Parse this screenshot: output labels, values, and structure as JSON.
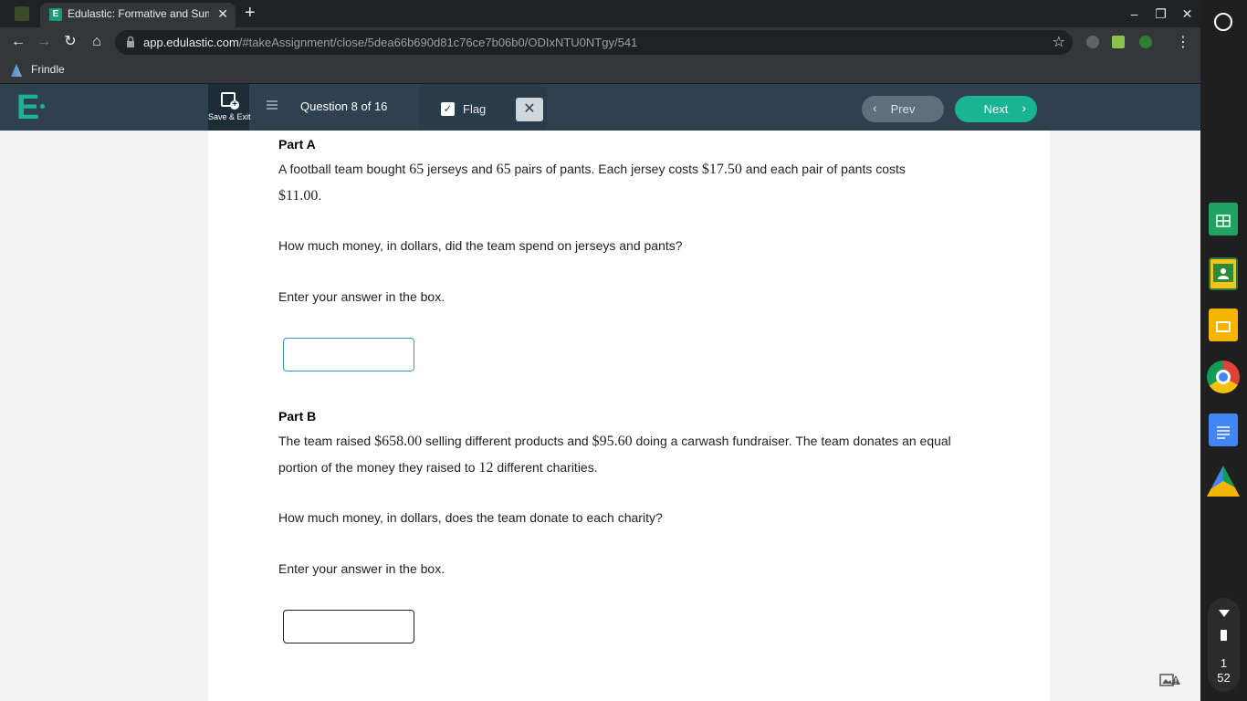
{
  "browser": {
    "tab_title": "Edulastic: Formative and Summ",
    "tab_close": "✕",
    "new_tab": "+",
    "url_host": "app.edulastic.com",
    "url_path": "/#takeAssignment/close/5dea66b690d81c76ce7b06b0/ODIxNTU0NTgy/541",
    "bookmark_label": "Frindle",
    "icons": [
      "back-icon",
      "forward-icon",
      "reload-icon",
      "home-icon",
      "lock-icon",
      "star-icon",
      "menu-icon"
    ]
  },
  "app": {
    "logo": "E",
    "save_exit_label": "Save & Exit",
    "question_counter": "Question 8 of 16",
    "flag_label": "Flag",
    "flag_checked": true,
    "close_symbol": "✕",
    "prev_label": "Prev",
    "next_label": "Next",
    "accent_color": "#1ab394",
    "header_color": "#2f4151"
  },
  "question": {
    "part_a": {
      "title": "Part A",
      "line1_pre": "A football team bought ",
      "num1": "65",
      "line1_mid1": " jerseys and ",
      "num2": "65",
      "line1_mid2": " pairs of pants. Each jersey costs ",
      "num3": "$17.50",
      "line1_post": " and each pair of pants costs",
      "num4": "$11.00",
      "line2_post": ".",
      "prompt": "How much money, in dollars, did the team spend on jerseys and pants?",
      "instruction": "Enter your answer in the box.",
      "answer_value": ""
    },
    "part_b": {
      "title": "Part B",
      "pre": "The team raised ",
      "num1": "$658.00",
      "mid1": " selling different products and ",
      "num2": "$95.60",
      "mid2": " doing a carwash fundraiser. The team donates an equal portion of the money they raised to ",
      "num3": "12",
      "post": " different charities.",
      "prompt": "How much money, in dollars, does the team donate to each charity?",
      "instruction": "Enter your answer in the box.",
      "answer_value": ""
    }
  },
  "shelf": {
    "apps": [
      "sheets-icon",
      "classroom-icon",
      "slides-icon",
      "chrome-icon",
      "docs-icon",
      "drive-icon"
    ],
    "clock_hour": "1",
    "clock_min": "52"
  }
}
